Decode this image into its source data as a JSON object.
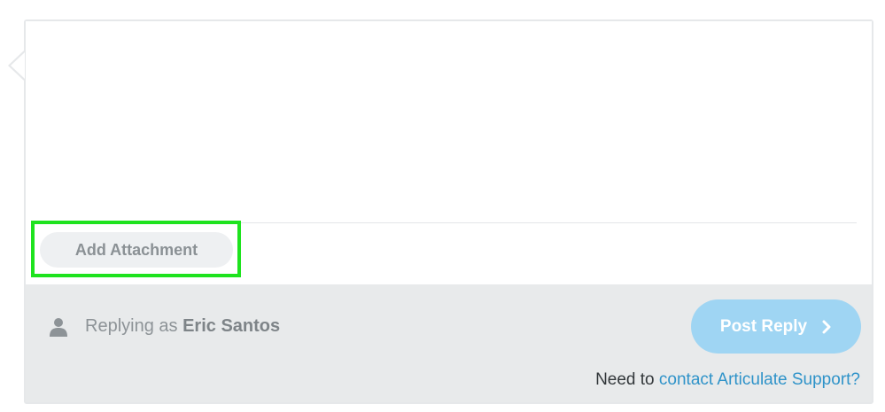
{
  "editor": {
    "content": ""
  },
  "attachment": {
    "button_label": "Add Attachment"
  },
  "footer": {
    "replying_prefix": "Replying as",
    "user_name": "Eric Santos",
    "post_button_label": "Post Reply",
    "support_prefix": "Need to",
    "support_link": "contact Articulate Support?"
  },
  "icons": {
    "user": "user-icon",
    "post_chevron": "chevron-right-icon"
  },
  "colors": {
    "highlight": "#1ee31e",
    "post_button": "#9fd5f3",
    "link": "#2f93c9",
    "footer_bg": "#e8eaeb"
  }
}
